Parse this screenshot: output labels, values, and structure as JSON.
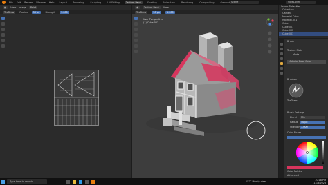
{
  "menu": {
    "items": [
      "File",
      "Edit",
      "Render",
      "Window",
      "Help"
    ],
    "tabs": [
      "Layout",
      "Modeling",
      "Sculpting",
      "UV Editing",
      "Texture Paint",
      "Shading",
      "Animation",
      "Rendering",
      "Compositing",
      "Geometry Nodes",
      "Scripting"
    ],
    "active_tab": "Texture Paint",
    "scene": "Scene",
    "view_layer": "ViewLayer"
  },
  "uv_editor": {
    "header": [
      "View",
      "Image"
    ],
    "header_mode": "Paint",
    "tool_brush": "TexDraw",
    "radius_label": "Radius",
    "radius_value": "50 px",
    "strength_label": "Strength",
    "strength_value": "1.000"
  },
  "viewport": {
    "header": [
      "Texture Paint",
      "View"
    ],
    "tool_brush": "TexDraw",
    "radius_value": "50 px",
    "strength_value": "1.000",
    "info_line1": "User Perspective",
    "info_line2": "(1) Cube.003"
  },
  "outliner": {
    "title": "Scene Collection",
    "rows": [
      "Collection",
      "Camera",
      "Material Cube",
      "Material.001",
      "Cube",
      "Cube.001",
      "Cube.002",
      "Cube.003"
    ]
  },
  "properties": {
    "labels": [
      "Brush",
      "Texture Slots",
      "Mode",
      "Material Base Color",
      "Brushes",
      "TexDraw",
      "Brush Settings",
      "Blend",
      "Mix",
      "Radius",
      "50 px",
      "Strength",
      "1.000",
      "Color Picker",
      "Color Palette",
      "Advanced",
      "Texture",
      "Stroke",
      "Falloff",
      "Cursor"
    ]
  },
  "status": {
    "search_placeholder": "Type here to search",
    "weather": "15°C Mostly clear",
    "time": "10:18 PM",
    "date": "11/13/2023"
  },
  "colors": {
    "accent": "#4772b3",
    "paint": "#d8355d",
    "logo": "#e87d0d"
  }
}
